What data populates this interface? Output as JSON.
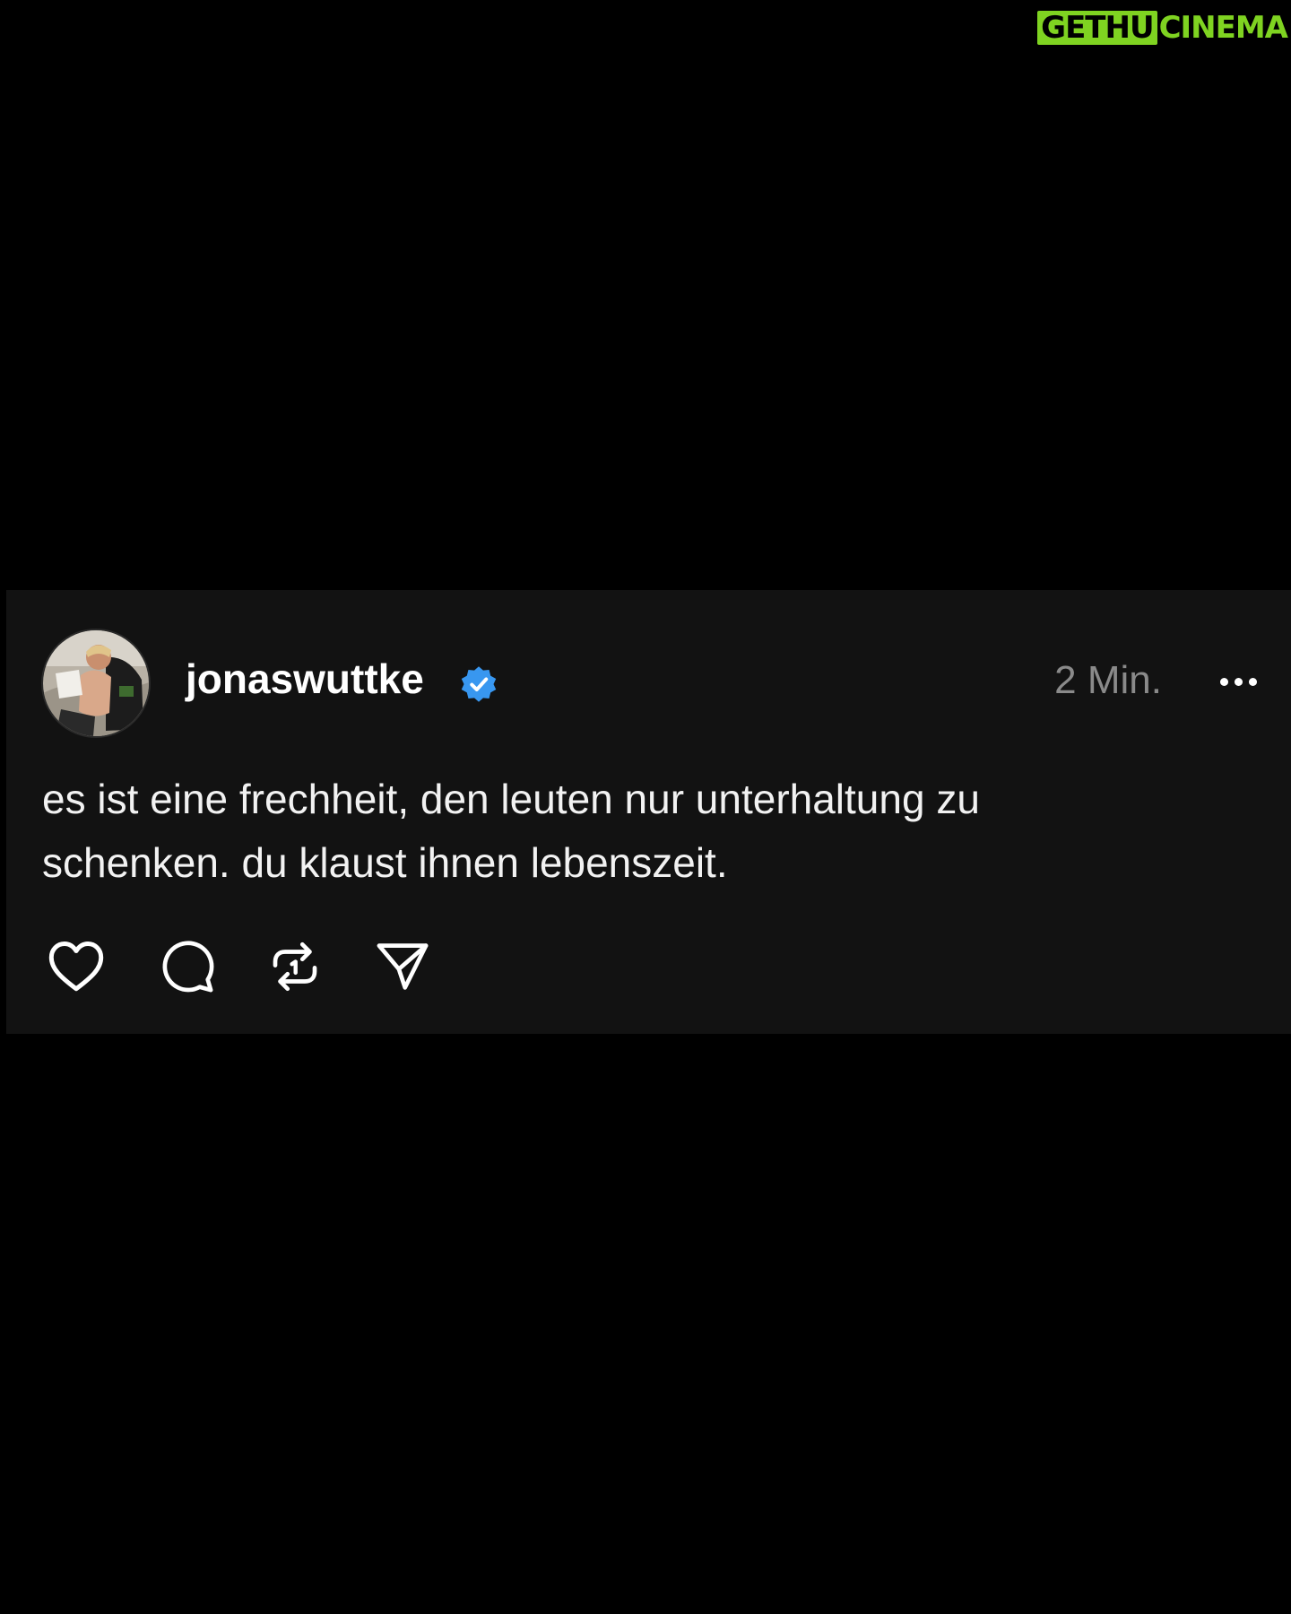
{
  "watermark": {
    "left": "GETHU",
    "right": "CINEMA",
    "color": "#7fd321"
  },
  "post": {
    "author": {
      "username": "jonaswuttke",
      "verified": true,
      "verified_color": "#3897f0",
      "avatar_icon": "profile-photo"
    },
    "timestamp": "2 Min.",
    "more_icon": "more-horizontal-icon",
    "text": "es ist eine frechheit, den leuten nur unterhaltung zu\nschenken. du klaust ihnen lebenszeit.",
    "actions": [
      {
        "name": "like",
        "icon": "heart-icon"
      },
      {
        "name": "comment",
        "icon": "comment-icon"
      },
      {
        "name": "repost",
        "icon": "repost-icon"
      },
      {
        "name": "share",
        "icon": "send-icon"
      }
    ],
    "background": "#121212"
  }
}
